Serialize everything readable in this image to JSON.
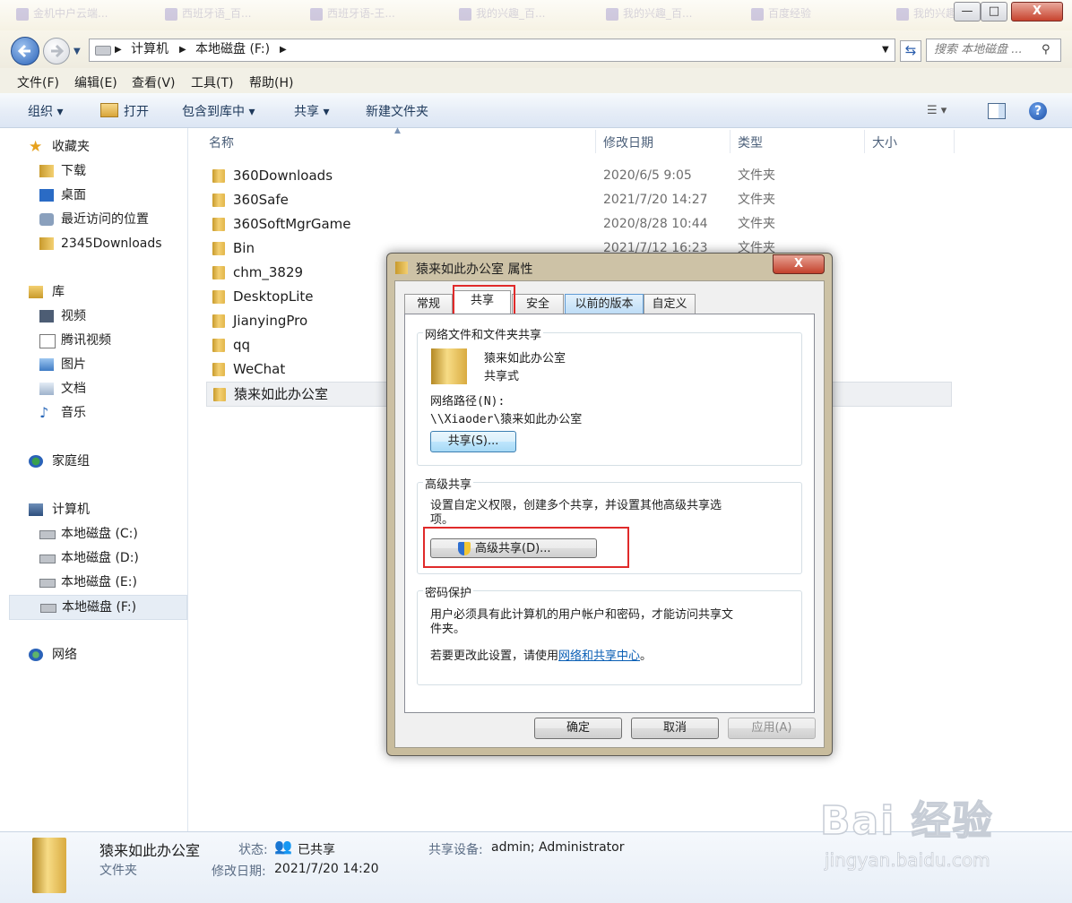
{
  "window": {
    "ghost_tabs": [
      "金机中户云端...",
      "西班牙语_百...",
      "西班牙语-王...",
      "我的兴趣_百...",
      "我的兴趣_百...",
      "百度经验",
      "我的兴趣"
    ],
    "minimize": "—",
    "maximize": "□",
    "close": "X"
  },
  "address": {
    "breadcrumb": [
      "计算机",
      "本地磁盘 (F:)"
    ],
    "search_placeholder": "搜索 本地磁盘 ..."
  },
  "menubar": [
    "文件(F)",
    "编辑(E)",
    "查看(V)",
    "工具(T)",
    "帮助(H)"
  ],
  "toolbar": {
    "organize": "组织 ▾",
    "open": "打开",
    "include_library": "包含到库中 ▾",
    "share": "共享 ▾",
    "new_folder": "新建文件夹"
  },
  "nav": {
    "favorites": "收藏夹",
    "fav_items": [
      "下载",
      "桌面",
      "最近访问的位置",
      "2345Downloads"
    ],
    "libraries": "库",
    "lib_items": [
      "视频",
      "腾讯视频",
      "图片",
      "文档",
      "音乐"
    ],
    "homegroup": "家庭组",
    "computer": "计算机",
    "drives": [
      "本地磁盘 (C:)",
      "本地磁盘 (D:)",
      "本地磁盘 (E:)",
      "本地磁盘 (F:)"
    ],
    "network": "网络"
  },
  "columns": {
    "name": "名称",
    "modified": "修改日期",
    "type": "类型",
    "size": "大小"
  },
  "files": [
    {
      "name": "360Downloads",
      "date": "2020/6/5 9:05",
      "type": "文件夹"
    },
    {
      "name": "360Safe",
      "date": "2021/7/20 14:27",
      "type": "文件夹"
    },
    {
      "name": "360SoftMgrGame",
      "date": "2020/8/28 10:44",
      "type": "文件夹"
    },
    {
      "name": "Bin",
      "date": "2021/7/12 16:23",
      "type": "文件夹"
    },
    {
      "name": "chm_3829",
      "date": "",
      "type": ""
    },
    {
      "name": "DesktopLite",
      "date": "",
      "type": ""
    },
    {
      "name": "JianyingPro",
      "date": "",
      "type": ""
    },
    {
      "name": "qq",
      "date": "",
      "type": ""
    },
    {
      "name": "WeChat",
      "date": "",
      "type": ""
    },
    {
      "name": "猿来如此办公室",
      "date": "",
      "type": ""
    }
  ],
  "details": {
    "name": "猿来如此办公室",
    "kind": "文件夹",
    "state_label": "状态:",
    "state_value": "已共享",
    "modified_label": "修改日期:",
    "modified_value": "2021/7/20 14:20",
    "shared_with_label": "共享设备:",
    "shared_with_value": "admin; Administrator"
  },
  "dialog": {
    "title": "猿来如此办公室 属性",
    "close": "X",
    "tabs": [
      "常规",
      "共享",
      "安全",
      "以前的版本",
      "自定义"
    ],
    "network_group_title": "网络文件和文件夹共享",
    "folder_name": "猿来如此办公室",
    "share_state": "共享式",
    "path_label": "网络路径(N):",
    "path_value": "\\\\Xiaoder\\猿来如此办公室",
    "share_button": "共享(S)...",
    "advanced_group_title": "高级共享",
    "advanced_desc_1": "设置自定义权限，创建多个共享，并设置其他高级共享选",
    "advanced_desc_2": "项。",
    "advanced_button": "高级共享(D)...",
    "password_group_title": "密码保护",
    "password_desc_1": "用户必须具有此计算机的用户帐户和密码，才能访问共享文",
    "password_desc_2": "件夹。",
    "password_change_prefix": "若要更改此设置，请使用",
    "password_link": "网络和共享中心",
    "password_change_suffix": "。",
    "ok": "确定",
    "cancel": "取消",
    "apply": "应用(A)"
  },
  "watermark": {
    "brand": "Bai  经验",
    "url": "jingyan.baidu.com"
  }
}
